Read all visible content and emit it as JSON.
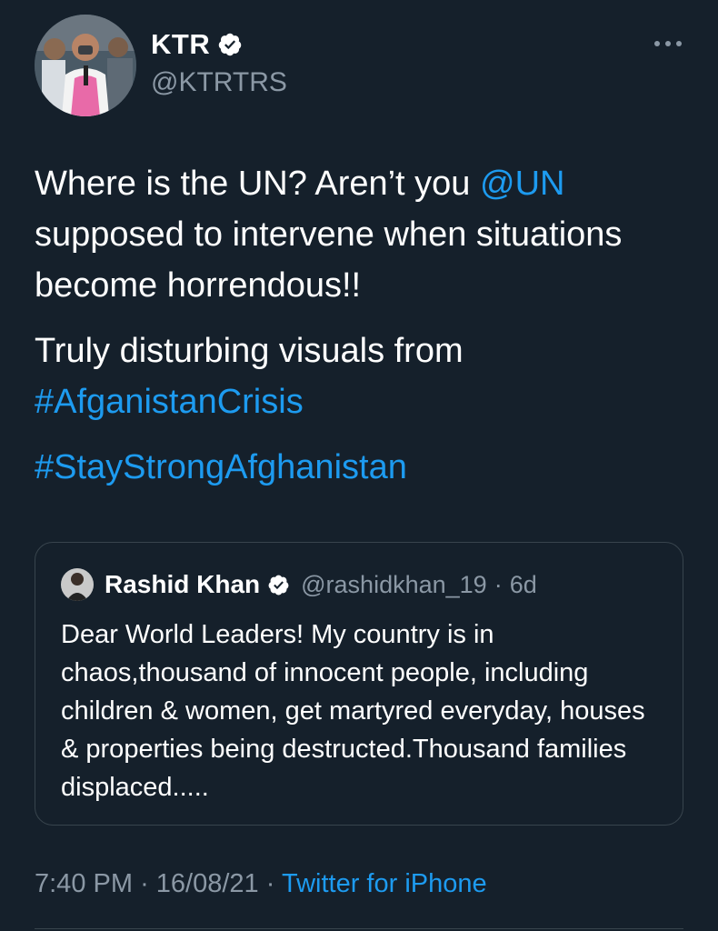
{
  "author": {
    "name": "KTR",
    "handle": "@KTRTRS",
    "verified": true,
    "avatar_icon": "profile-photo"
  },
  "menu": {
    "icon": "more-options-icon"
  },
  "tweet": {
    "line1_pre": "Where is the UN? Aren’t you ",
    "mention": "@UN",
    "line1_post": " supposed to intervene when situations become horrendous!!",
    "para2_text": "Truly disturbing visuals from ",
    "hashtag1": "#AfganistanCrisis",
    "hashtag2": "#StayStrongAfghanistan"
  },
  "quoted_tweet": {
    "name": "Rashid Khan",
    "verified": true,
    "handle": "@rashidkhan_19",
    "separator": "·",
    "age": "6d",
    "text": "Dear World Leaders! My country is in chaos,thousand of innocent people, including children & women, get martyred everyday, houses & properties being destructed.Thousand families displaced....."
  },
  "footer": {
    "time": "7:40 PM",
    "separator": "·",
    "date": "16/08/21",
    "source": "Twitter for iPhone"
  },
  "colors": {
    "background": "#15202b",
    "link": "#1d9bf0",
    "secondary_text": "#8b98a5",
    "border": "#38444d"
  }
}
